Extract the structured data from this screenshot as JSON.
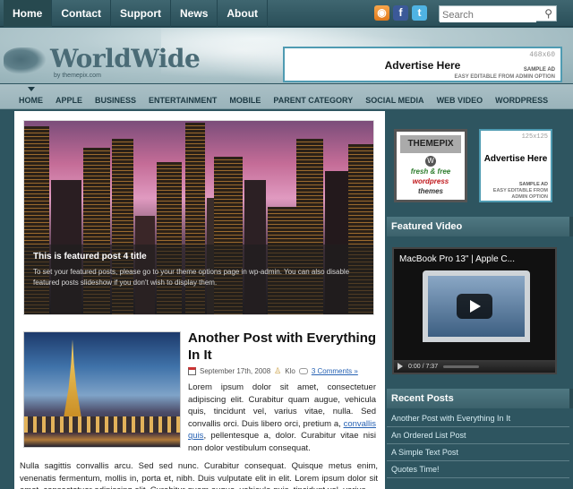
{
  "topnav": {
    "items": [
      "Home",
      "Contact",
      "Support",
      "News",
      "About"
    ]
  },
  "search": {
    "placeholder": "Search"
  },
  "header": {
    "logo": "WorldWide",
    "tagline": "by themepix.com",
    "advert": {
      "size": "468x60",
      "title": "Advertise Here",
      "sample": "SAMPLE AD",
      "edit": "EASY EDITABLE FROM ADMIN OPTION"
    }
  },
  "categories": [
    "HOME",
    "APPLE",
    "BUSINESS",
    "ENTERTAINMENT",
    "MOBILE",
    "PARENT CATEGORY",
    "SOCIAL MEDIA",
    "WEB VIDEO",
    "WORDPRESS"
  ],
  "slider": {
    "title": "This is featured post 4 title",
    "description": "To set your featured posts, please go to your theme options page in wp-admin. You can also disable featured posts slideshow if you don't wish to display them."
  },
  "post": {
    "title": "Another Post with Everything In It",
    "date": "September 17th, 2008",
    "author": "Klo",
    "comments": "3 Comments »",
    "excerpt_start": "Lorem ipsum dolor sit amet, consectetuer adipiscing elit. Curabitur quam augue, vehicula quis, tincidunt vel, varius vitae, nulla. Sed convallis orci. Duis libero orci, pretium a,",
    "excerpt_link": "convallis quis",
    "excerpt_end": ", pellentesque a, dolor. Curabitur vitae nisi non dolor vestibulum consequat.",
    "more": "Nulla sagittis convallis arcu. Sed sed nunc. Curabitur consequat. Quisque metus enim, venenatis fermentum, mollis in, porta et, nibh. Duis vulputate elit in elit. Lorem ipsum dolor sit amet, consectetuer adipiscing elit. Curabitur quam augue, vehicula quis, tincidunt vel, varius"
  },
  "sidebar": {
    "themepix_ad": {
      "brand": "THEMEPIX",
      "fresh": "fresh",
      "and_free": "& free",
      "wordpress": "wordpress",
      "themes": "themes"
    },
    "small_ad": {
      "size": "125x125",
      "title": "Advertise Here",
      "sample": "SAMPLE AD",
      "edit": "EASY EDITABLE FROM ADMIN OPTION"
    },
    "featured_video": {
      "heading": "Featured Video",
      "title": "MacBook Pro 13\" | Apple C...",
      "time": "0:00 / 7:37"
    },
    "recent_posts": {
      "heading": "Recent Posts",
      "items": [
        "Another Post with Everything In It",
        "An Ordered List Post",
        "A Simple Text Post",
        "Quotes Time!"
      ]
    }
  },
  "colors": {
    "link": "#2762b3",
    "ad_border": "#4f9bb2",
    "background": "#2e5560"
  }
}
